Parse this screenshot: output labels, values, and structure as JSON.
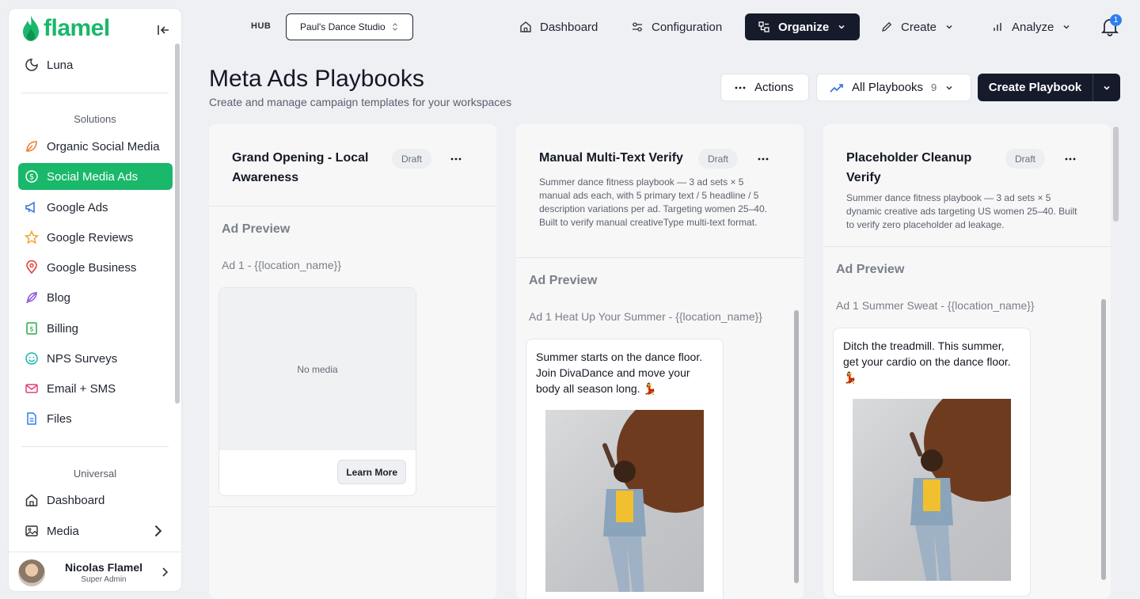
{
  "app": {
    "logo_text": "flamel",
    "brand_color": "#19b86a"
  },
  "sidebar": {
    "top_item": {
      "label": "Luna",
      "icon": "moon-icon"
    },
    "solutions_label": "Solutions",
    "solutions": [
      {
        "label": "Organic Social Media",
        "icon": "leaf-icon"
      },
      {
        "label": "Social Media Ads",
        "icon": "dollar-circle-icon",
        "active": true
      },
      {
        "label": "Google Ads",
        "icon": "megaphone-icon"
      },
      {
        "label": "Google Reviews",
        "icon": "star-icon"
      },
      {
        "label": "Google Business",
        "icon": "map-pin-icon"
      },
      {
        "label": "Blog",
        "icon": "feather-icon"
      },
      {
        "label": "Billing",
        "icon": "billing-icon"
      },
      {
        "label": "NPS Surveys",
        "icon": "smile-icon"
      },
      {
        "label": "Email + SMS",
        "icon": "mail-icon"
      },
      {
        "label": "Files",
        "icon": "file-icon"
      }
    ],
    "universal_label": "Universal",
    "universal": [
      {
        "label": "Dashboard",
        "icon": "home-icon"
      },
      {
        "label": "Media",
        "icon": "image-icon"
      }
    ],
    "user": {
      "name": "Nicolas Flamel",
      "role": "Super Admin"
    }
  },
  "topbar": {
    "hub_label": "HUB",
    "workspace": "Paul's Dance Studio",
    "nav": [
      {
        "label": "Dashboard",
        "icon": "home-icon"
      },
      {
        "label": "Configuration",
        "icon": "sliders-icon"
      },
      {
        "label": "Organize",
        "icon": "organize-icon",
        "active": true
      },
      {
        "label": "Create",
        "icon": "pen-icon"
      },
      {
        "label": "Analyze",
        "icon": "bar-chart-icon"
      }
    ],
    "notification_count": "1"
  },
  "page": {
    "title": "Meta Ads Playbooks",
    "subtitle": "Create and manage campaign templates for your workspaces",
    "actions_label": "Actions",
    "filter_label": "All Playbooks",
    "filter_count": "9",
    "create_label": "Create Playbook"
  },
  "cards": [
    {
      "title": "Grand Opening - Local Awareness",
      "status": "Draft",
      "description": "",
      "preview_label": "Ad Preview",
      "ad_title": "Ad 1 - {{location_name}}",
      "no_media_label": "No media",
      "cta_label": "Learn More"
    },
    {
      "title": "Manual Multi-Text Verify",
      "status": "Draft",
      "description": "Summer dance fitness playbook — 3 ad sets × 5 manual ads each, with 5 primary text / 5 headline / 5 description variations per ad. Targeting women 25–40. Built to verify manual creativeType multi-text format.",
      "preview_label": "Ad Preview",
      "ad_title": "Ad 1 Heat Up Your Summer - {{location_name}}",
      "ad_text": "Summer starts on the dance floor. Join DivaDance and move your body all season long. 💃"
    },
    {
      "title": "Placeholder Cleanup Verify",
      "status": "Draft",
      "description": "Summer dance fitness playbook — 3 ad sets × 5 dynamic creative ads targeting US women 25–40. Built to verify zero placeholder ad leakage.",
      "preview_label": "Ad Preview",
      "ad_title": "Ad 1 Summer Sweat - {{location_name}}",
      "ad_text": "Ditch the treadmill. This summer, get your cardio on the dance floor. 💃"
    }
  ]
}
